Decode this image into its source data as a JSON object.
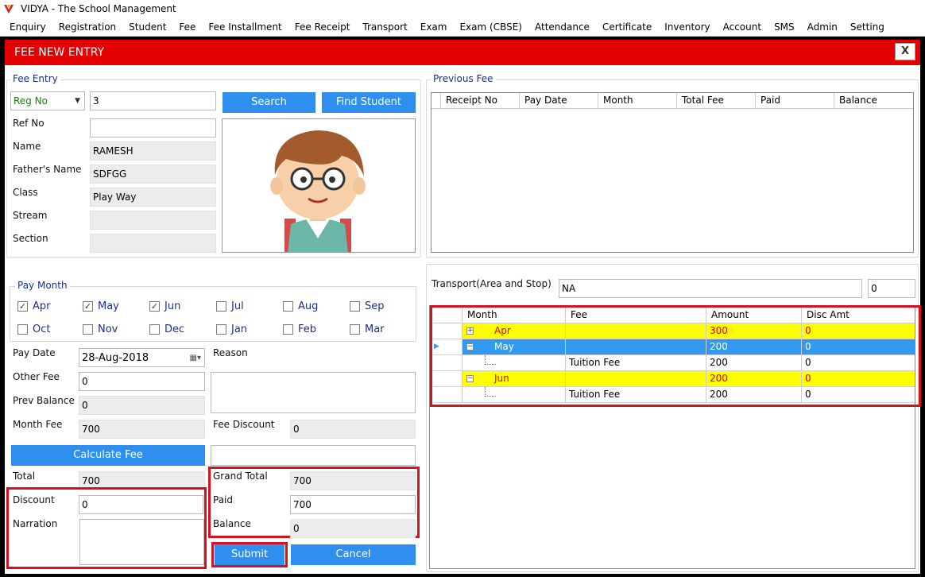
{
  "app": {
    "title": "VIDYA - The School Management"
  },
  "menu": [
    "Enquiry",
    "Registration",
    "Student",
    "Fee",
    "Fee Installment",
    "Fee Receipt",
    "Transport",
    "Exam",
    "Exam (CBSE)",
    "Attendance",
    "Certificate",
    "Inventory",
    "Account",
    "SMS",
    "Admin",
    "Setting"
  ],
  "window": {
    "title": "FEE NEW ENTRY",
    "close_label": "X"
  },
  "fee_entry": {
    "group_label": "Fee Entry",
    "search_by": "Reg No",
    "search_value": "3",
    "search_button": "Search",
    "find_button": "Find Student",
    "ref_no_label": "Ref No",
    "ref_no": "",
    "name_label": "Name",
    "name": "RAMESH",
    "father_label": "Father's Name",
    "father": "SDFGG",
    "class_label": "Class",
    "class": "Play Way",
    "stream_label": "Stream",
    "stream": "",
    "section_label": "Section",
    "section": ""
  },
  "previous_fee": {
    "group_label": "Previous Fee",
    "columns": [
      "Receipt No",
      "Pay Date",
      "Month",
      "Total Fee",
      "Paid",
      "Balance"
    ]
  },
  "pay_month": {
    "group_label": "Pay Month",
    "months": [
      {
        "label": "Apr",
        "checked": true
      },
      {
        "label": "May",
        "checked": true
      },
      {
        "label": "Jun",
        "checked": true
      },
      {
        "label": "Jul",
        "checked": false
      },
      {
        "label": "Aug",
        "checked": false
      },
      {
        "label": "Sep",
        "checked": false
      },
      {
        "label": "Oct",
        "checked": false
      },
      {
        "label": "Nov",
        "checked": false
      },
      {
        "label": "Dec",
        "checked": false
      },
      {
        "label": "Jan",
        "checked": false
      },
      {
        "label": "Feb",
        "checked": false
      },
      {
        "label": "Mar",
        "checked": false
      }
    ]
  },
  "payment": {
    "pay_date_label": "Pay Date",
    "pay_date": "28-Aug-2018",
    "reason_label": "Reason",
    "reason": "",
    "other_fee_label": "Other Fee",
    "other_fee": "0",
    "prev_balance_label": "Prev Balance",
    "prev_balance": "0",
    "month_fee_label": "Month Fee",
    "month_fee": "700",
    "fee_discount_label": "Fee Discount",
    "fee_discount": "0",
    "calculate_button": "Calculate Fee",
    "total_label": "Total",
    "total": "700",
    "discount_label": "Discount",
    "discount": "0",
    "narration_label": "Narration",
    "narration": "",
    "grand_total_label": "Grand Total",
    "grand_total": "700",
    "paid_label": "Paid",
    "paid": "700",
    "balance_label": "Balance",
    "balance": "0",
    "submit_button": "Submit",
    "cancel_button": "Cancel"
  },
  "transport": {
    "label": "Transport(Area and Stop)",
    "area": "NA",
    "amount": "0"
  },
  "fee_grid": {
    "columns": [
      "Month",
      "Fee",
      "Amount",
      "Disc Amt"
    ],
    "rows": [
      {
        "month": "Apr",
        "fee": "",
        "amount": "300",
        "disc": "0",
        "style": "yellow",
        "expander": "+"
      },
      {
        "month": "May",
        "fee": "",
        "amount": "200",
        "disc": "0",
        "style": "selected",
        "expander": "-"
      },
      {
        "month": "",
        "fee": "Tuition Fee",
        "amount": "200",
        "disc": "0",
        "style": "child"
      },
      {
        "month": "Jun",
        "fee": "",
        "amount": "200",
        "disc": "0",
        "style": "yellow",
        "expander": "-"
      },
      {
        "month": "",
        "fee": "Tuition Fee",
        "amount": "200",
        "disc": "0",
        "style": "child"
      }
    ]
  },
  "colors": {
    "header_red": "#e30000",
    "button_blue": "#2f8fef",
    "highlight_red": "#d6121f",
    "row_yellow": "#ffff00",
    "row_selected": "#3399ee"
  }
}
